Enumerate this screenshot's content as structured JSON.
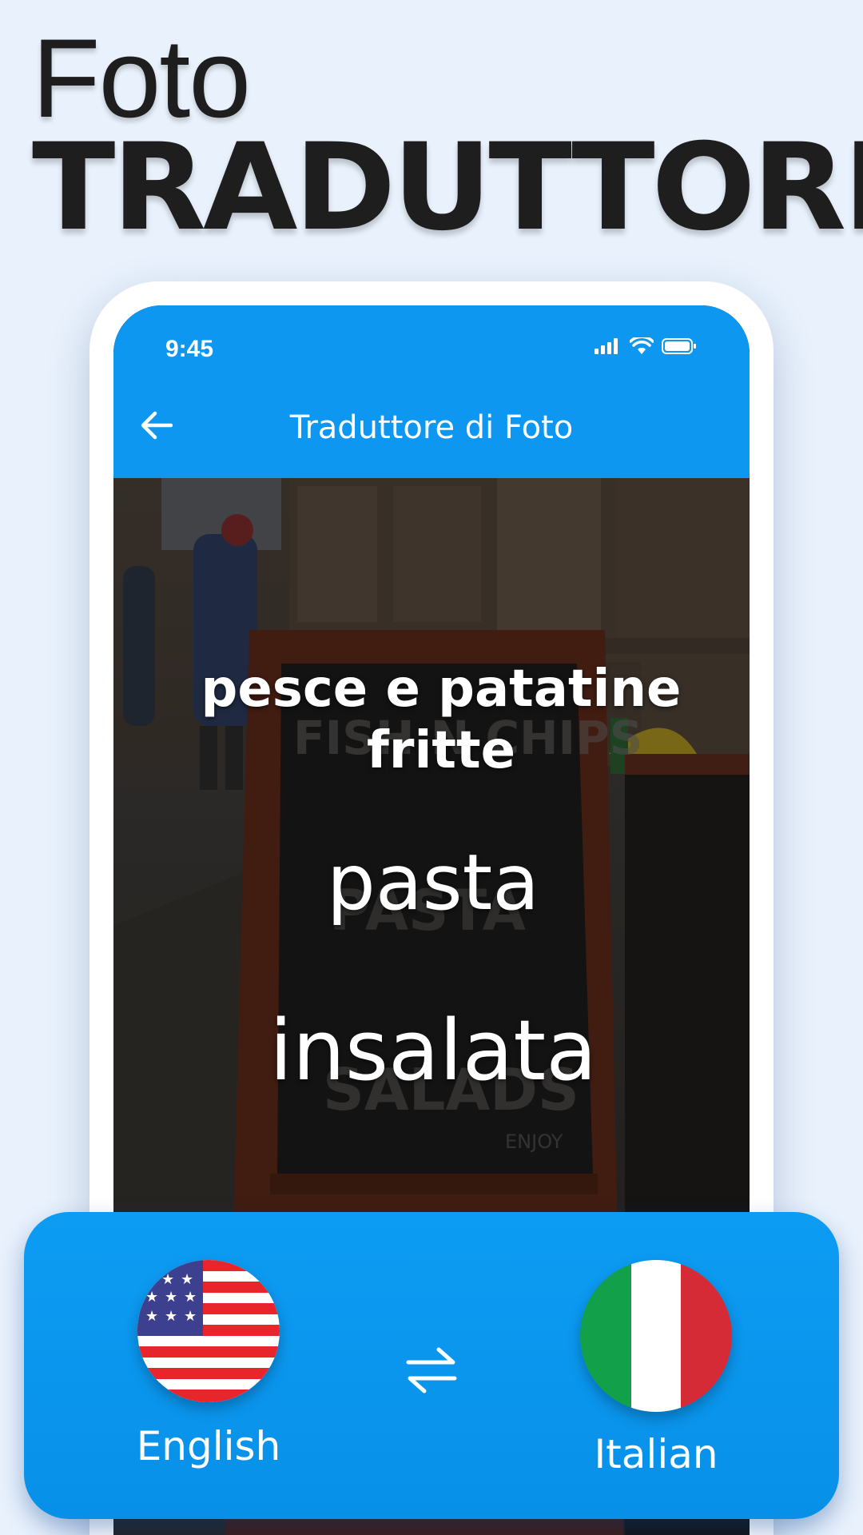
{
  "headline": {
    "line1": "Foto",
    "line2": "TRADUTTORE"
  },
  "status_bar": {
    "time": "9:45",
    "icons": [
      "cellular-signal-icon",
      "wifi-icon",
      "battery-icon"
    ]
  },
  "app_bar": {
    "title": "Traduttore di Foto",
    "back_icon": "back-arrow-icon"
  },
  "photo_overlay": {
    "translations": [
      "pesce e patatine fritte",
      "pasta",
      "insalata"
    ]
  },
  "language_panel": {
    "source_language": "English",
    "target_language": "Italian",
    "source_flag": "us-flag-icon",
    "target_flag": "italy-flag-icon",
    "swap_icon": "swap-arrows-icon"
  },
  "colors": {
    "background": "#e8f1fc",
    "accent": "#0e97f1",
    "headline": "#1e1e1e"
  }
}
